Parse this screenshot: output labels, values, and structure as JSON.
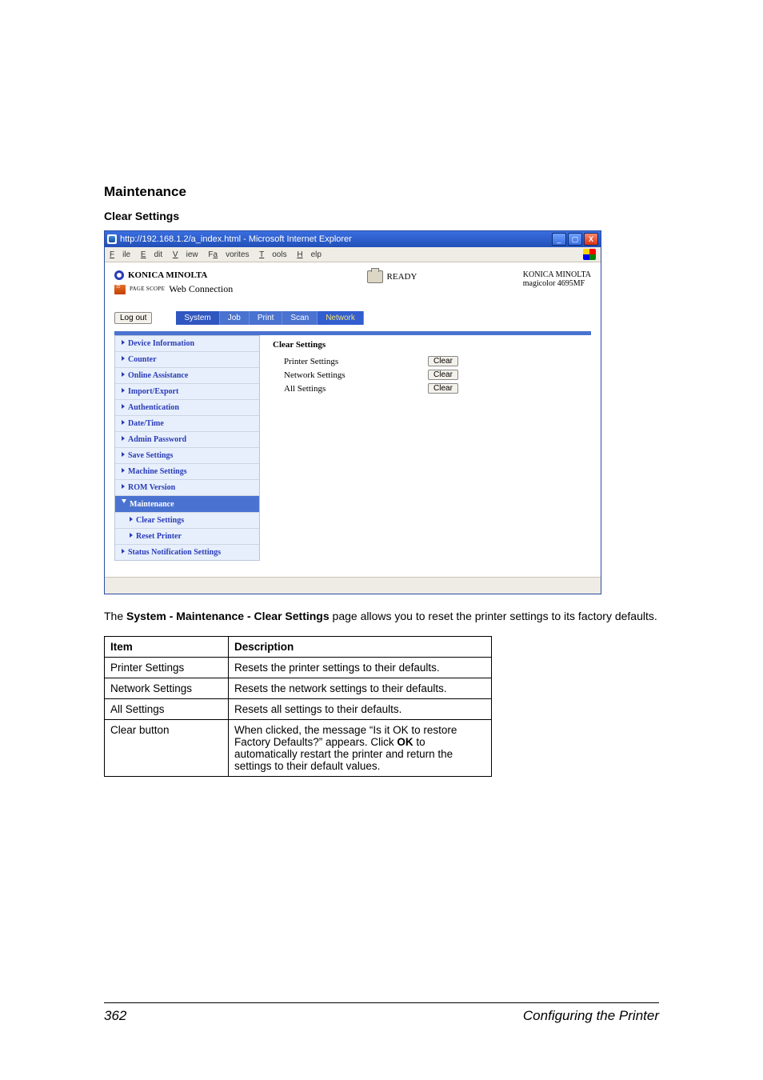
{
  "headings": {
    "main": "Maintenance",
    "sub": "Clear Settings"
  },
  "screenshot": {
    "window_title": "http://192.168.1.2/a_index.html - Microsoft Internet Explorer",
    "menus": [
      "File",
      "Edit",
      "View",
      "Favorites",
      "Tools",
      "Help"
    ],
    "brand": {
      "name": "KONICA MINOLTA",
      "app_prefix": "PAGE SCOPE",
      "app": "Web Connection"
    },
    "status_word": "READY",
    "device": {
      "brand": "KONICA MINOLTA",
      "model": "magicolor 4695MF"
    },
    "logout": "Log out",
    "tabs": [
      "System",
      "Job",
      "Print",
      "Scan",
      "Network"
    ],
    "sidebar": [
      {
        "label": "Device Information"
      },
      {
        "label": "Counter"
      },
      {
        "label": "Online Assistance"
      },
      {
        "label": "Import/Export"
      },
      {
        "label": "Authentication"
      },
      {
        "label": "Date/Time"
      },
      {
        "label": "Admin Password"
      },
      {
        "label": "Save Settings"
      },
      {
        "label": "Machine Settings"
      },
      {
        "label": "ROM Version"
      },
      {
        "label": "Maintenance",
        "active": true
      },
      {
        "label": "Clear Settings",
        "sub": true
      },
      {
        "label": "Reset Printer",
        "sub": true
      },
      {
        "label": "Status Notification Settings"
      }
    ],
    "content": {
      "title": "Clear Settings",
      "rows": [
        {
          "label": "Printer Settings",
          "button": "Clear"
        },
        {
          "label": "Network Settings",
          "button": "Clear"
        },
        {
          "label": "All Settings",
          "button": "Clear"
        }
      ]
    }
  },
  "description": {
    "pre": "The ",
    "boldpath": "System - Maintenance - Clear Settings",
    "post": " page allows you to reset the printer settings to its factory defaults."
  },
  "table": {
    "headers": [
      "Item",
      "Description"
    ],
    "rows": [
      {
        "item": "Printer Settings",
        "desc": "Resets the printer settings to their defaults."
      },
      {
        "item": "Network Settings",
        "desc": "Resets the network settings to their defaults."
      },
      {
        "item": "All Settings",
        "desc": "Resets all settings to their defaults."
      },
      {
        "item": "Clear button",
        "desc_pre": "When clicked, the message “Is it OK to restore Factory Defaults?” appears. Click ",
        "desc_bold": "OK",
        "desc_post": " to automatically restart the printer and return the settings to their default values."
      }
    ]
  },
  "footer": {
    "pagenum": "362",
    "title": "Configuring the Printer"
  }
}
